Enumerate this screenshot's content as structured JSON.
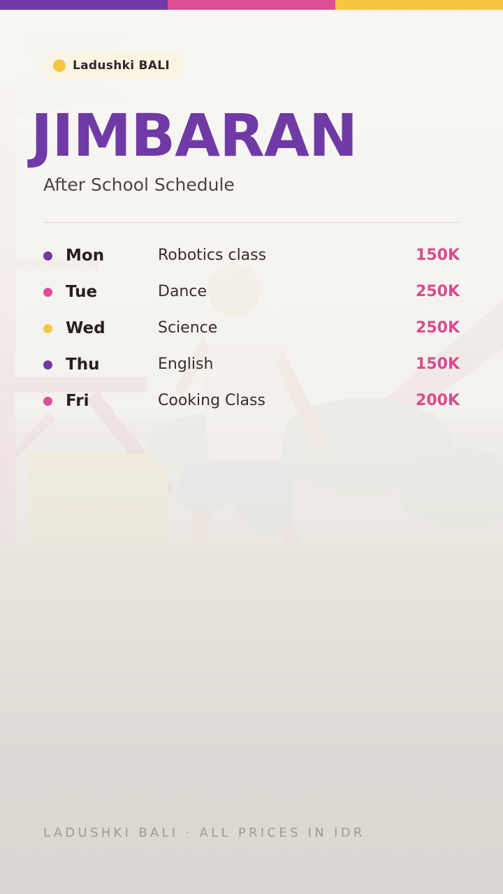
{
  "colors": {
    "purple": "#6f3aa6",
    "pink": "#dd4f96",
    "yellow": "#f6c544",
    "price_pink": "#d94b8f"
  },
  "top_bar": {
    "segments": [
      "#6f3aa6",
      "#dd4f96",
      "#f6c544"
    ]
  },
  "brand": {
    "label": "Ladushki BALI",
    "dot_color": "#f6c544"
  },
  "headline": {
    "title": "JIMBARAN",
    "color": "#6f3aa6",
    "subtitle": "After School Schedule"
  },
  "schedule": [
    {
      "day": "Mon",
      "activity": "Robotics class",
      "price": "150K",
      "dot_color": "#6f3aa6"
    },
    {
      "day": "Tue",
      "activity": "Dance",
      "price": "250K",
      "dot_color": "#dd4f96"
    },
    {
      "day": "Wed",
      "activity": "Science",
      "price": "250K",
      "dot_color": "#f6c544"
    },
    {
      "day": "Thu",
      "activity": "English",
      "price": "150K",
      "dot_color": "#6f3aa6"
    },
    {
      "day": "Fri",
      "activity": "Cooking Class",
      "price": "200K",
      "dot_color": "#dd4f96"
    }
  ],
  "footer": {
    "text": "LADUSHKI BALI · ALL PRICES IN IDR"
  }
}
